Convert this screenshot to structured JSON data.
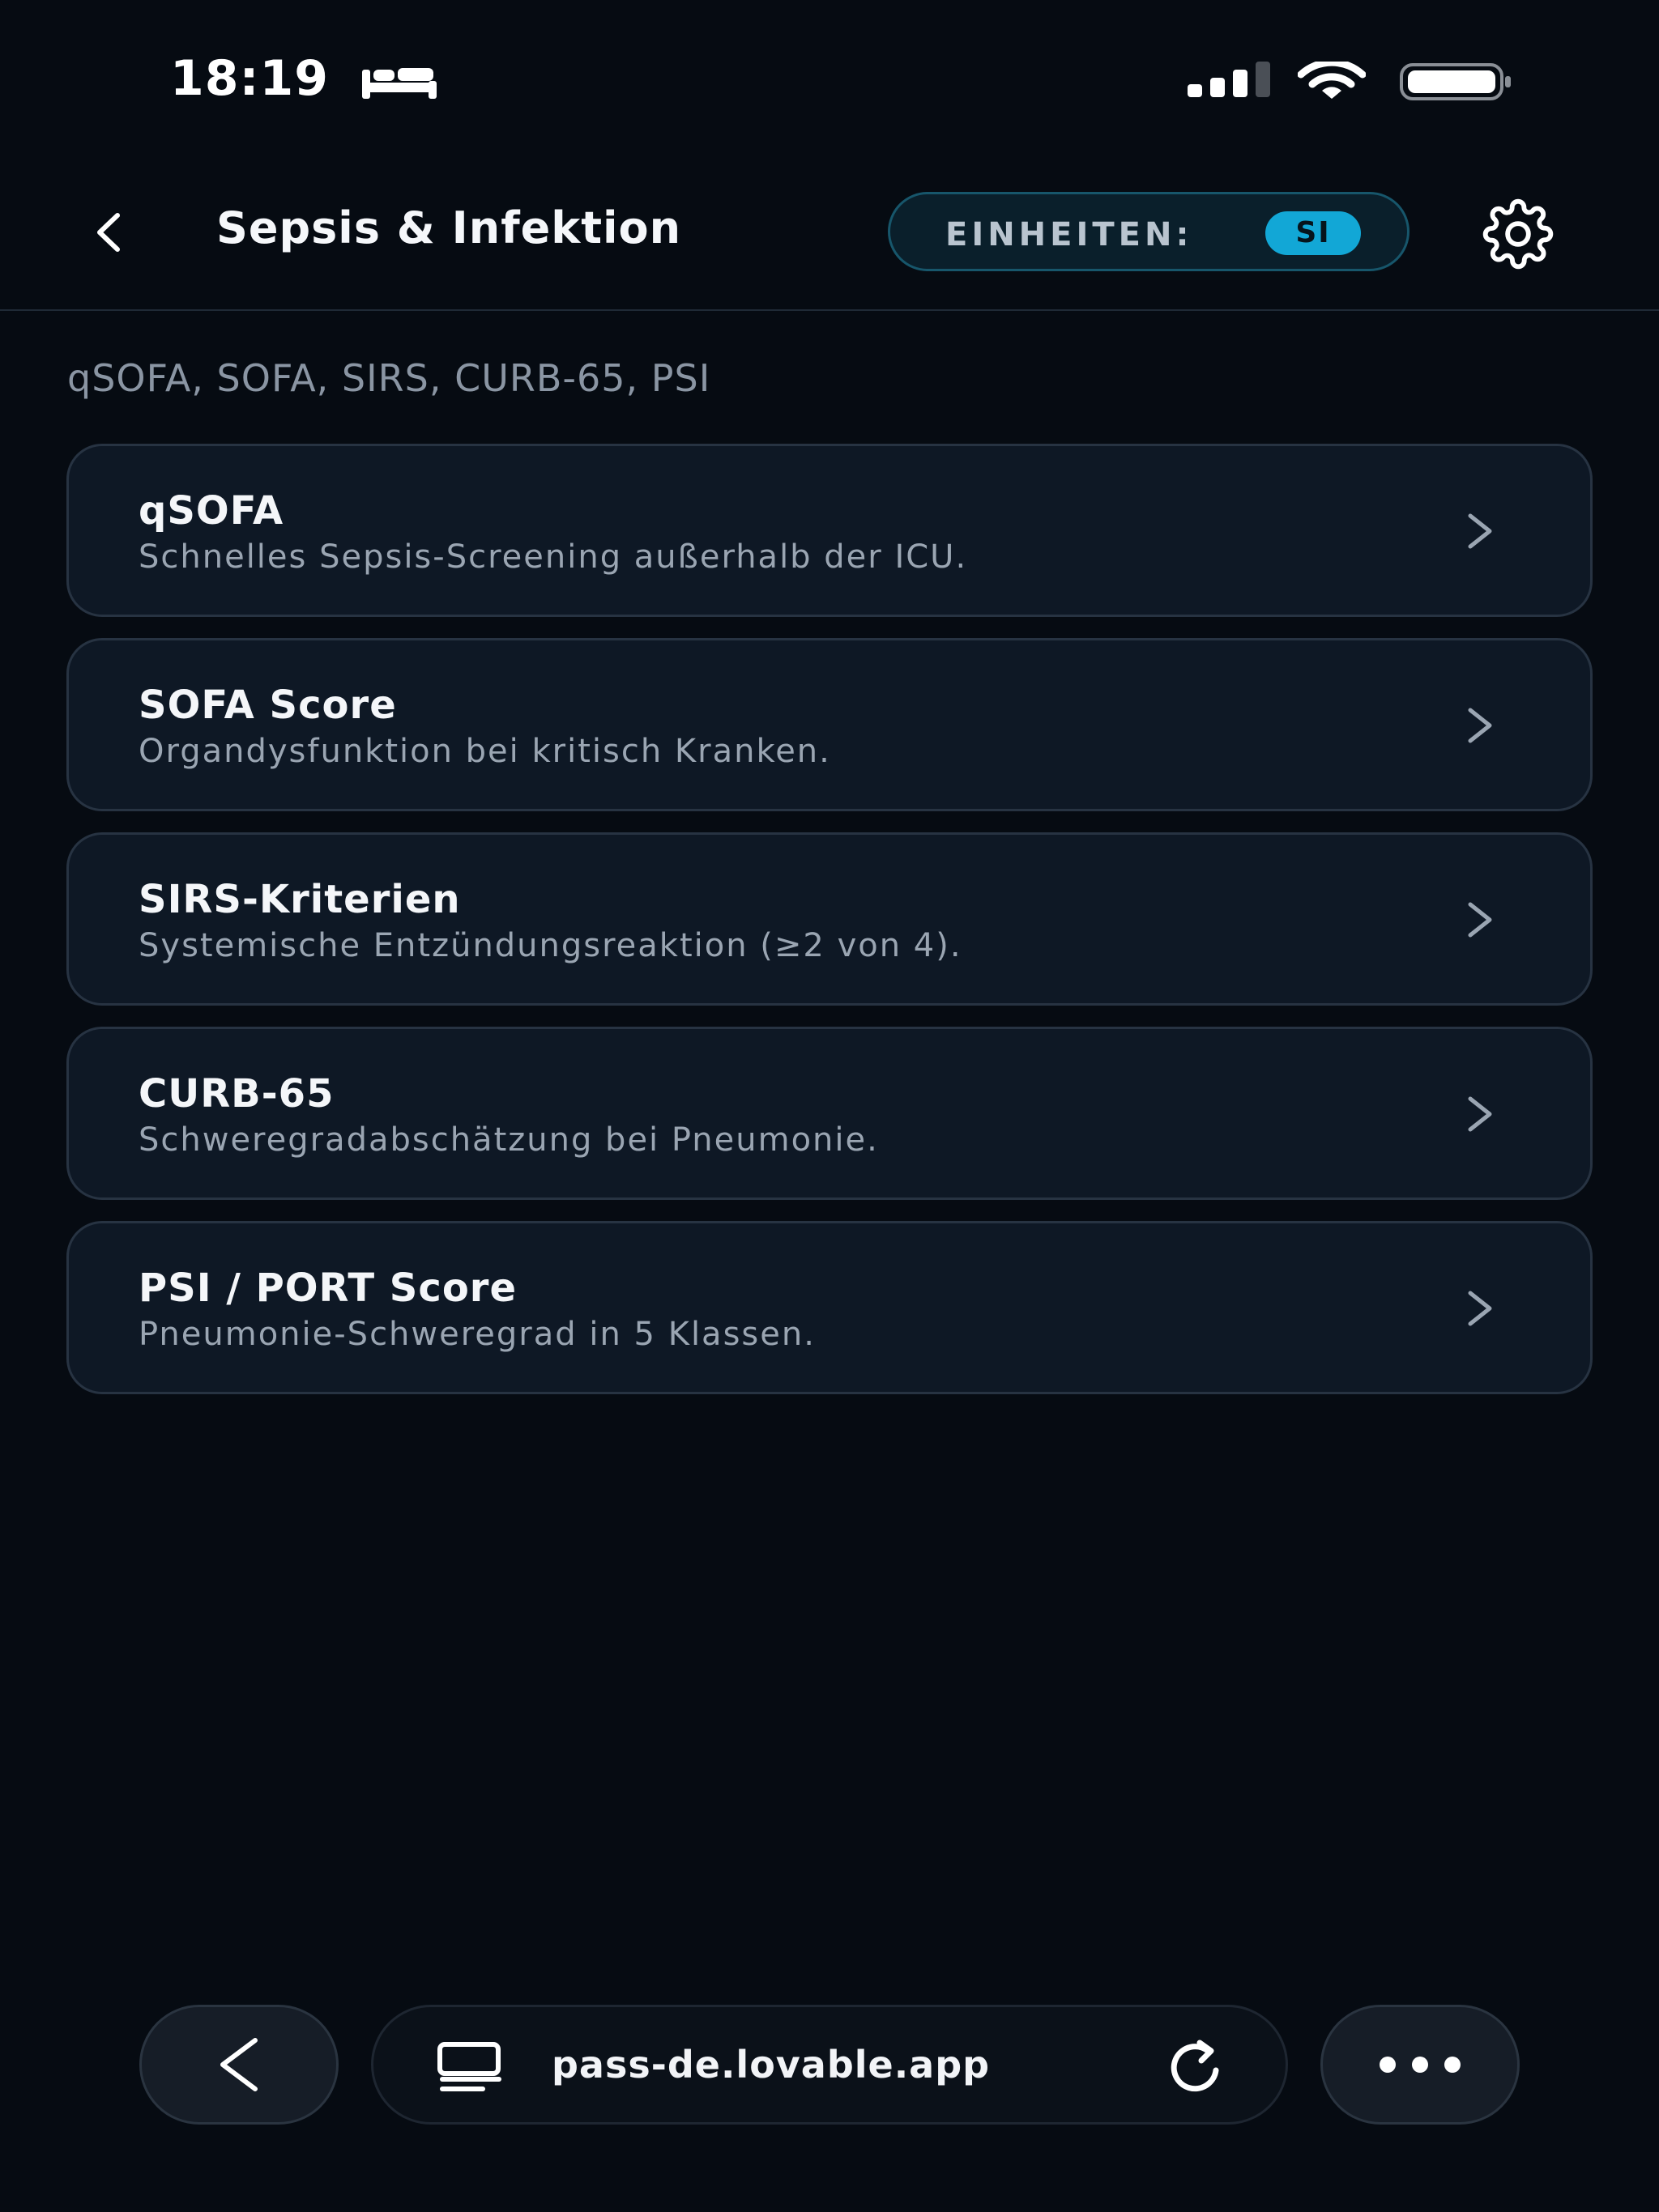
{
  "status_bar": {
    "time": "18:19",
    "icons": [
      "bed-icon",
      "signal-icon",
      "wifi-icon",
      "battery-icon"
    ]
  },
  "header": {
    "back_icon": "chevron-left-icon",
    "title": "Sepsis & Infektion",
    "units_label": "EINHEITEN:",
    "units_value": "SI",
    "settings_icon": "gear-icon"
  },
  "subtitle": "qSOFA, SOFA, SIRS, CURB-65, PSI",
  "cards": [
    {
      "title": "qSOFA",
      "description": "Schnelles Sepsis-Screening außerhalb der ICU."
    },
    {
      "title": "SOFA Score",
      "description": "Organdysfunktion bei kritisch Kranken."
    },
    {
      "title": "SIRS-Kriterien",
      "description": "Systemische Entzündungsreaktion (≥2 von 4)."
    },
    {
      "title": "CURB-65",
      "description": "Schweregradabschätzung bei Pneumonie."
    },
    {
      "title": "PSI / PORT Score",
      "description": "Pneumonie-Schweregrad in 5 Klassen."
    }
  ],
  "browser": {
    "url": "pass-de.lovable.app",
    "icons": [
      "chevron-left-icon",
      "tab-icon",
      "reload-icon",
      "more-icon"
    ]
  },
  "colors": {
    "background": "#060b12",
    "card": "#0e1825",
    "accent": "#12a7d6"
  }
}
